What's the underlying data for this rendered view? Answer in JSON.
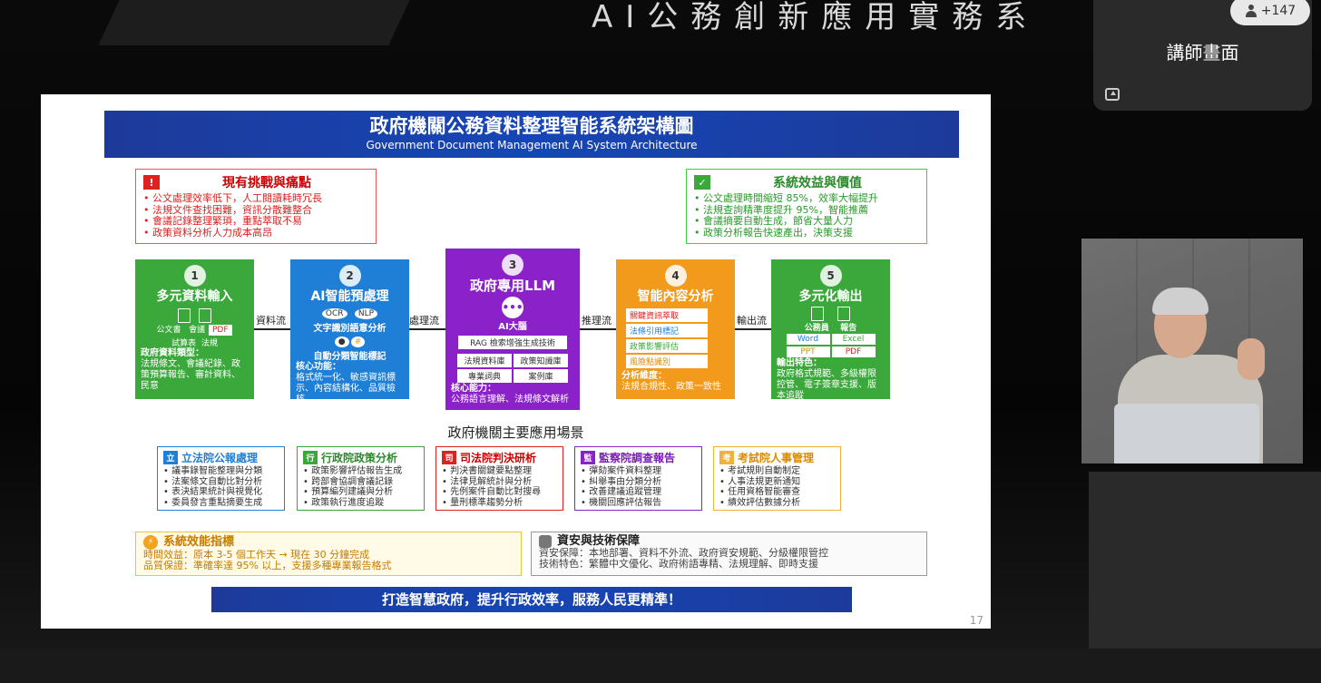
{
  "meeting": {
    "stage_title": "AI公務創新應用實務系",
    "participants_count": "+147",
    "speaker_view_label": "講師畫面"
  },
  "slide": {
    "title_zh": "政府機關公務資料整理智能系統架構圖",
    "title_en": "Government Document Management AI System Architecture",
    "page_number": "17",
    "challenges": {
      "badge": "!",
      "title": "現有挑戰與痛點",
      "items": [
        "公文處理效率低下，人工閱讀耗時冗長",
        "法規文件查找困難，資訊分散難整合",
        "會議記錄整理繁瑣，重點萃取不易",
        "政策資料分析人力成本高昂"
      ]
    },
    "benefits": {
      "badge": "✓",
      "title": "系統效益與價值",
      "items": [
        "公文處理時間縮短 85%，效率大幅提升",
        "法規查詢精準度提升 95%，智能推薦",
        "會議摘要自動生成，節省大量人力",
        "政策分析報告快速產出，決策支援"
      ]
    },
    "pipeline": {
      "s1": {
        "num": "1",
        "name": "多元資料輸入",
        "docs": "公文書",
        "docs2": "會議",
        "pdf": "PDF",
        "docs3": "試算表",
        "docs4": "法規",
        "type_label": "政府資料類型：",
        "types": "法規條文、會議紀錄、政策預算報告、審計資料、民意"
      },
      "flow1": "資料流",
      "s2": {
        "num": "2",
        "name": "AI智能預處理",
        "ocr": "OCR",
        "nlp": "NLP",
        "l1": "文字識別語意分析",
        "l2": "自動分類智能標記",
        "core_label": "核心功能：",
        "core": "格式統一化、敏感資訊標示、內容結構化、品質檢核"
      },
      "flow2": "處理流",
      "s3": {
        "num": "3",
        "name": "政府專用LLM",
        "brain": "AI大腦",
        "rag": "RAG 檢索增強生成技術",
        "c1": "法規資料庫",
        "c2": "政策知識庫",
        "c3": "專業詞典",
        "c4": "案例庫",
        "core_label": "核心能力：",
        "core": "公務語言理解、法規條文解析"
      },
      "flow3": "推理流",
      "s4": {
        "num": "4",
        "name": "智能內容分析",
        "i1": "關鍵資訊萃取",
        "i2": "法條引用標記",
        "i3": "政策影響評估",
        "i4": "風險點識別",
        "dim_label": "分析維度：",
        "dims": "法規合規性、政策一致性"
      },
      "flow4": "輸出流",
      "s5": {
        "num": "5",
        "name": "多元化輸出",
        "o1": "公務員",
        "o2": "報告",
        "f1": "Word",
        "f2": "Excel",
        "f3": "PPT",
        "f4": "PDF",
        "feat_label": "輸出特色：",
        "feat": "政府格式規範、多級權限控管、電子簽章支援、版本追蹤"
      }
    },
    "scenes_title": "政府機關主要應用場景",
    "scenes": [
      {
        "badge": "立",
        "title": "立法院公報處理",
        "items": [
          "議事錄智能整理與分類",
          "法案條文自動比對分析",
          "表決結果統計與視覺化",
          "委員發言重點摘要生成"
        ]
      },
      {
        "badge": "行",
        "title": "行政院政策分析",
        "items": [
          "政策影響評估報告生成",
          "跨部會協調會議記錄",
          "預算編列建議與分析",
          "政策執行進度追蹤"
        ]
      },
      {
        "badge": "司",
        "title": "司法院判決研析",
        "items": [
          "判決書關鍵要點整理",
          "法律見解統計與分析",
          "先例案件自動比對搜尋",
          "量刑標準趨勢分析"
        ]
      },
      {
        "badge": "監",
        "title": "監察院調查報告",
        "items": [
          "彈劾案件資料整理",
          "糾舉事由分類分析",
          "改善建議追蹤管理",
          "機關回應評估報告"
        ]
      },
      {
        "badge": "考",
        "title": "考試院人事管理",
        "items": [
          "考試規則自動制定",
          "人事法規更新通知",
          "任用資格智能審查",
          "績效評估數據分析"
        ]
      }
    ],
    "metrics": {
      "title": "系統效能指標",
      "l1": "時間效益：原本 3-5 個工作天 → 現在 30 分鐘完成",
      "l2": "品質保證：準確率達 95% 以上，支援多種專業報告格式"
    },
    "security": {
      "title": "資安與技術保障",
      "l1": "資安保障：本地部署、資料不外流、政府資安規範、分級權限管控",
      "l2": "技術特色：繁體中文優化、政府術語專精、法規理解、即時支援"
    },
    "footer": "打造智慧政府，提升行政效率，服務人民更精準！"
  }
}
